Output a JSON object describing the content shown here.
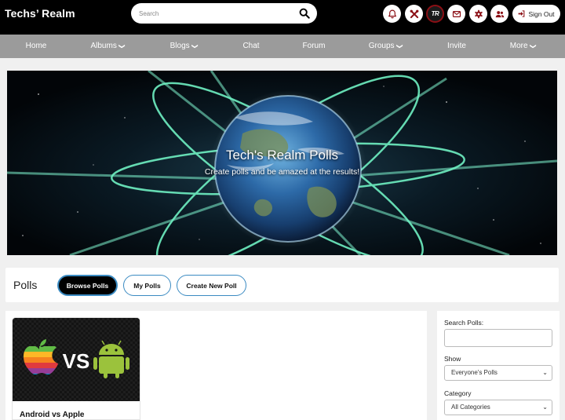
{
  "header": {
    "site_title": "Techs’ Realm",
    "search_placeholder": "Search",
    "tr_badge": "TR",
    "sign_out_label": "Sign Out",
    "icons": [
      "bell-icon",
      "tools-icon",
      "tr-badge",
      "envelope-icon",
      "gear-icon",
      "users-icon"
    ],
    "accent_color": "#8b0f15"
  },
  "nav": {
    "items": [
      {
        "label": "Home"
      },
      {
        "label": "Albums",
        "dropdown": true
      },
      {
        "label": "Blogs",
        "dropdown": true
      },
      {
        "label": "Chat"
      },
      {
        "label": "Forum"
      },
      {
        "label": "Groups",
        "dropdown": true
      },
      {
        "label": "Invite"
      },
      {
        "label": "More",
        "dropdown": true
      }
    ],
    "background": "#9b9b9b"
  },
  "banner": {
    "title": "Tech's Realm Polls",
    "subtitle": "Create polls and be amazed at the results!"
  },
  "polls_bar": {
    "title": "Polls",
    "tabs": [
      {
        "label": "Browse Polls",
        "active": true
      },
      {
        "label": "My Polls",
        "active": false
      },
      {
        "label": "Create New Poll",
        "active": false
      }
    ],
    "accent_color": "#3b8bc2"
  },
  "poll_cards": [
    {
      "title": "Android vs Apple",
      "thumb_text": "VS"
    }
  ],
  "sidebar": {
    "search_label": "Search Polls:",
    "search_value": "",
    "show_label": "Show",
    "show_value": "Everyone's Polls",
    "category_label": "Category",
    "category_value": "All Categories"
  }
}
